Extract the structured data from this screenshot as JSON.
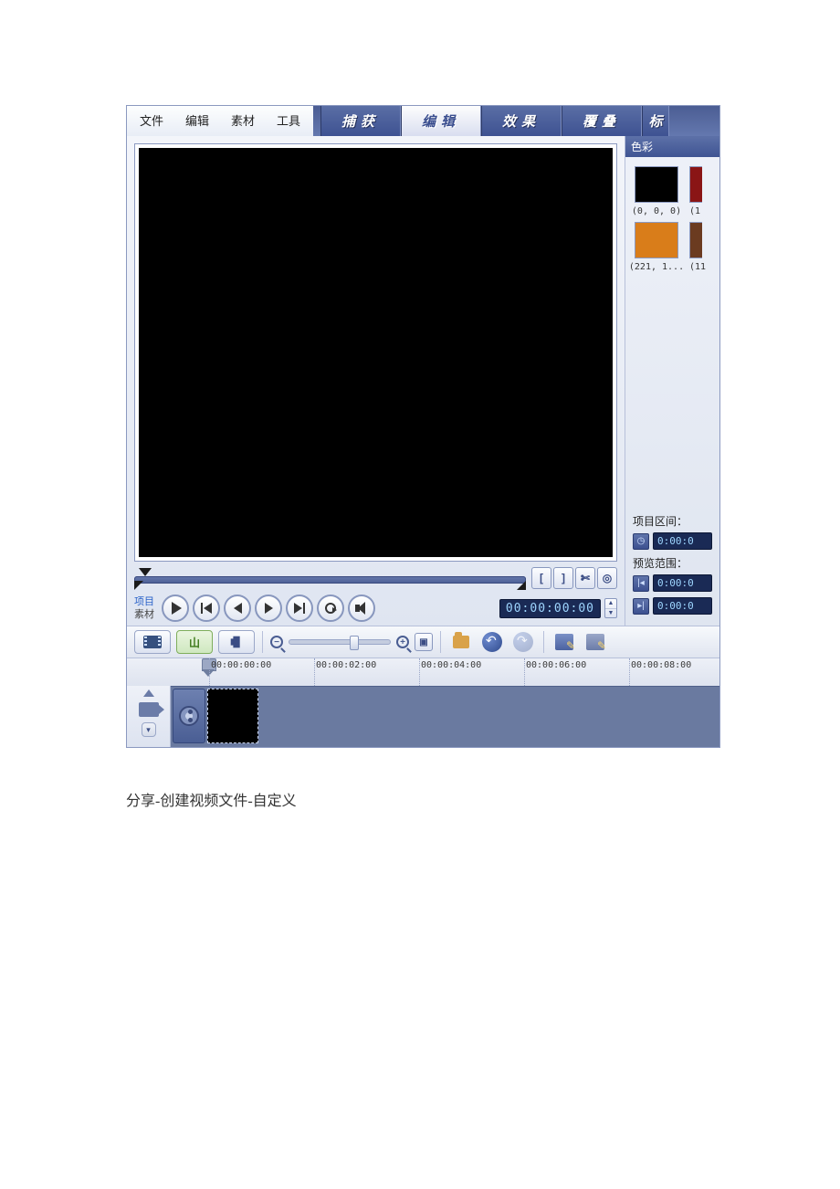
{
  "menu": {
    "file": "文件",
    "edit": "编辑",
    "clip": "素材",
    "tools": "工具"
  },
  "steps": {
    "capture": "捕获",
    "edit": "编辑",
    "effect": "效果",
    "overlay": "覆叠",
    "title": "标"
  },
  "trim": {
    "mark_in": "[",
    "mark_out": "]",
    "cut": "✄",
    "enlarge": "◎"
  },
  "modes": {
    "project": "项目",
    "clip": "素材"
  },
  "timecode": "00:00:00:00",
  "gallery": {
    "header": "色彩",
    "swatches": [
      {
        "color": "#000000",
        "label": "(0, 0, 0)"
      },
      {
        "color": "#8a1515",
        "label": "(1"
      },
      {
        "color": "#d97d1a",
        "label": "(221, 1..."
      },
      {
        "color": "#6b3b20",
        "label": "(11"
      }
    ]
  },
  "proj": {
    "interval_label": "项目区间：",
    "interval_val": "0:00:0",
    "range_label": "预览范围：",
    "range_start": "0:00:0",
    "range_end": "0:00:0"
  },
  "ruler": [
    {
      "pos": 90,
      "label": "00:00:00:00"
    },
    {
      "pos": 205,
      "label": "00:00:02:00"
    },
    {
      "pos": 320,
      "label": "00:00:04:00"
    },
    {
      "pos": 435,
      "label": "00:00:06:00"
    },
    {
      "pos": 550,
      "label": "00:00:08:00"
    }
  ],
  "caption": "分享-创建视频文件-自定义"
}
